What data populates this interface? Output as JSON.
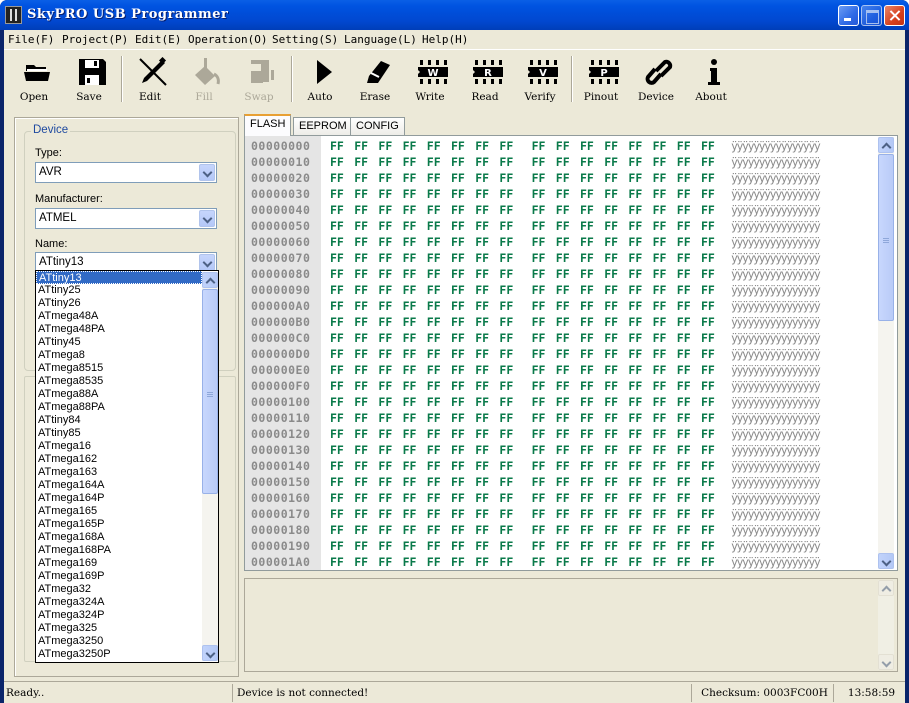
{
  "window": {
    "title": "SkyPRO USB Programmer"
  },
  "menu": [
    {
      "label": "File(F)"
    },
    {
      "label": "Project(P)"
    },
    {
      "label": "Edit(E)"
    },
    {
      "label": "Operation(O)"
    },
    {
      "label": "Setting(S)"
    },
    {
      "label": "Language(L)"
    },
    {
      "label": "Help(H)"
    }
  ],
  "toolbar": {
    "open": "Open",
    "save": "Save",
    "edit": "Edit",
    "fill": "Fill",
    "swap": "Swap",
    "auto": "Auto",
    "erase": "Erase",
    "write": "Write",
    "read": "Read",
    "verify": "Verify",
    "pinout": "Pinout",
    "device": "Device",
    "about": "About",
    "chip_letters": {
      "write": "W",
      "read": "R",
      "verify": "V",
      "pinout": "P"
    },
    "disabled": [
      "Fill",
      "Swap"
    ]
  },
  "device_panel": {
    "group_title": "Device",
    "type_label": "Type:",
    "type_value": "AVR",
    "manufacturer_label": "Manufacturer:",
    "manufacturer_value": "ATMEL",
    "name_label": "Name:",
    "name_value": "ATtiny13",
    "name_options": [
      "ATtiny13",
      "ATtiny25",
      "ATtiny26",
      "ATmega48A",
      "ATmega48PA",
      "ATtiny45",
      "ATmega8",
      "ATmega8515",
      "ATmega8535",
      "ATmega88A",
      "ATmega88PA",
      "ATtiny84",
      "ATtiny85",
      "ATmega16",
      "ATmega162",
      "ATmega163",
      "ATmega164A",
      "ATmega164P",
      "ATmega165",
      "ATmega165P",
      "ATmega168A",
      "ATmega168PA",
      "ATmega169",
      "ATmega169P",
      "ATmega32",
      "ATmega324A",
      "ATmega324P",
      "ATmega325",
      "ATmega3250",
      "ATmega3250P"
    ],
    "selected_index": 0
  },
  "tabs": [
    {
      "label": "FLASH",
      "active": true
    },
    {
      "label": "EEPROM",
      "active": false
    },
    {
      "label": "CONFIG",
      "active": false
    }
  ],
  "hex": {
    "addresses": [
      "00000000",
      "00000010",
      "00000020",
      "00000030",
      "00000040",
      "00000050",
      "00000060",
      "00000070",
      "00000080",
      "00000090",
      "000000A0",
      "000000B0",
      "000000C0",
      "000000D0",
      "000000E0",
      "000000F0",
      "00000100",
      "00000110",
      "00000120",
      "00000130",
      "00000140",
      "00000150",
      "00000160",
      "00000170",
      "00000180",
      "00000190",
      "000001A0"
    ],
    "byte_value": "FF",
    "bytes_per_row": 16,
    "ascii": "ÿÿÿÿÿÿÿÿÿÿÿÿÿÿÿÿ",
    "colors": {
      "byte": "#0a7a4a",
      "address": "#8a8a8a"
    }
  },
  "status": {
    "left": "Ready..",
    "connection": "Device is not connected!",
    "checksum": "Checksum: 0003FC00H",
    "time": "13:58:59"
  }
}
